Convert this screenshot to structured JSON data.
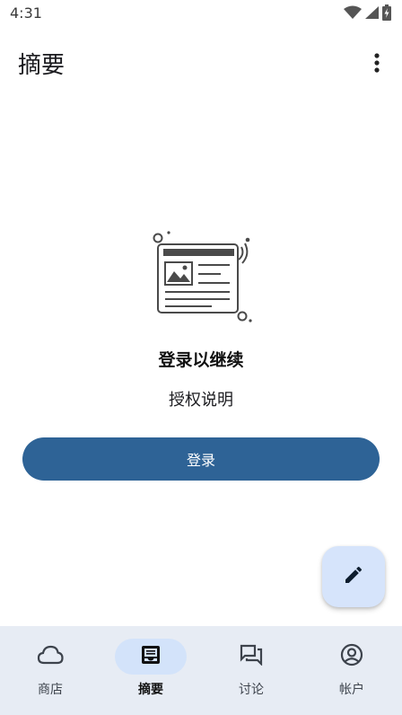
{
  "status_bar": {
    "time": "4:31",
    "icons": [
      "wifi-icon",
      "cellular-signal-icon",
      "battery-charging-icon"
    ]
  },
  "app_bar": {
    "title": "摘要",
    "menu_icon": "more-vert-icon"
  },
  "empty_state": {
    "illustration": "news-article-illustration",
    "title": "登录以继续",
    "description": "授权说明",
    "login_button_label": "登录"
  },
  "fab": {
    "icon": "pencil-icon"
  },
  "bottom_nav": {
    "items": [
      {
        "label": "商店",
        "icon": "cloud-icon",
        "active": false
      },
      {
        "label": "摘要",
        "icon": "inbox-icon",
        "active": true
      },
      {
        "label": "讨论",
        "icon": "forum-icon",
        "active": false
      },
      {
        "label": "帐户",
        "icon": "account-circle-icon",
        "active": false
      }
    ]
  },
  "colors": {
    "primary_button": "#2e6396",
    "fab_background": "#d6e4fb",
    "nav_background": "#e7ecf4",
    "nav_active_indicator": "#d3e3fa"
  }
}
